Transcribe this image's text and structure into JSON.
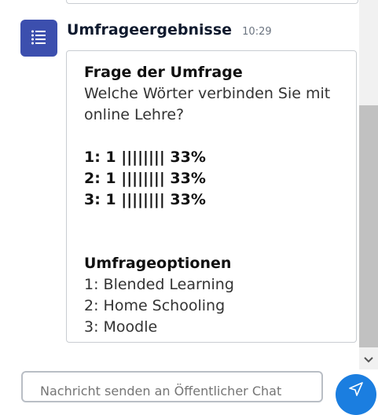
{
  "message": {
    "sender": "Umfrageergebnisse",
    "time": "10:29",
    "avatar_icon": "poll-list-icon"
  },
  "poll": {
    "question_heading": "Frage der Umfrage",
    "question_line1": "Welche Wörter verbinden Sie mit",
    "question_line2": "online Lehre?",
    "results": [
      "1: 1 |||||||| 33%",
      "2: 1 |||||||| 33%",
      "3: 1 |||||||| 33%"
    ],
    "options_heading": "Umfrageoptionen",
    "options": [
      "1: Blended Learning",
      "2: Home Schooling",
      "3: Moodle"
    ]
  },
  "composer": {
    "placeholder": "Nachricht senden an Öffentlicher Chat"
  },
  "colors": {
    "avatar_bg": "#3c4fae",
    "send_button": "#1b7ee0",
    "card_border": "#c9cdd2"
  }
}
